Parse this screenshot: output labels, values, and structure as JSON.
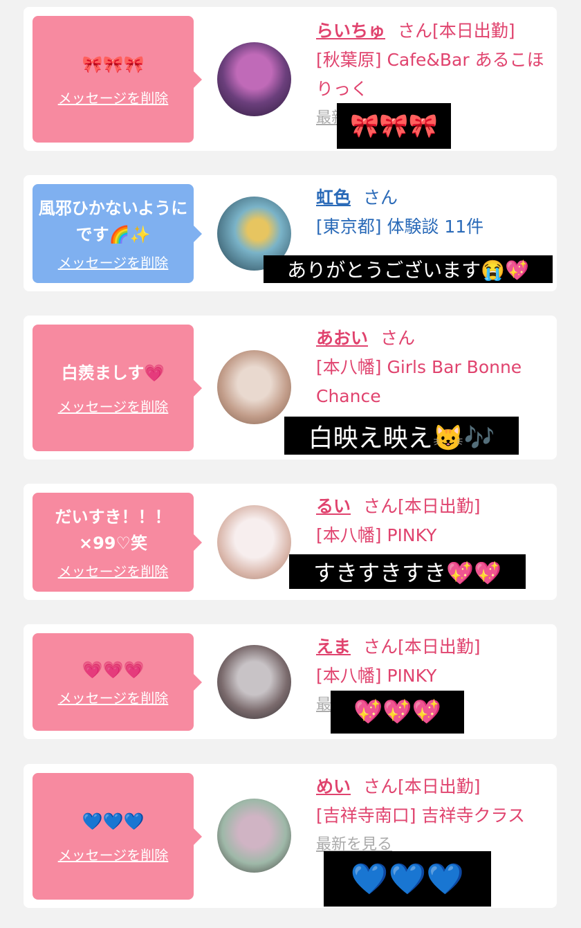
{
  "delete_label": "メッセージを削除",
  "see_latest_label": "最新を見る",
  "cards": [
    {
      "message": "🎀🎀🎀",
      "name": "らいちゅ",
      "suffix": "さん[本日出勤]",
      "shop": "[秋葉原] Cafe&Bar あるこほりっく",
      "overlay": "🎀🎀🎀",
      "avatar_colors": [
        "#2b1a3a",
        "#c06ab8",
        "#6b3f7c"
      ]
    },
    {
      "message": "風邪ひかないようにです🌈✨",
      "name": "虹色",
      "suffix": "さん",
      "shop": "[東京都] 体験談 11件",
      "overlay": "ありがとうございます😭💖",
      "avatar_colors": [
        "#1f3a48",
        "#7ab3c8",
        "#e7c560"
      ]
    },
    {
      "message": "白羨ましす💗",
      "name": "あおい",
      "suffix": "さん",
      "shop": "[本八幡] Girls Bar Bonne Chance",
      "overlay": "白映え映え😺🎶",
      "avatar_colors": [
        "#e9d9cf",
        "#c29d8a",
        "#7a5a48"
      ]
    },
    {
      "message": "だいすき！！！×99♡笑",
      "name": "るい",
      "suffix": "さん[本日出勤]",
      "shop": "[本八幡] PINKY",
      "overlay": "すきすきすき💖💖",
      "avatar_colors": [
        "#f7eeee",
        "#d9b6aa",
        "#a07d6c"
      ]
    },
    {
      "message": "💗💗💗",
      "name": "えま",
      "suffix": "さん[本日出勤]",
      "shop": "[本八幡] PINKY",
      "overlay": "💖💖💖",
      "avatar_colors": [
        "#2a2a2e",
        "#c8c3c6",
        "#7a6a6c"
      ]
    },
    {
      "message": "💙💙💙",
      "name": "めい",
      "suffix": "さん[本日出勤]",
      "shop": "[吉祥寺南口] 吉祥寺クラス",
      "overlay": "💙💙💙",
      "avatar_colors": [
        "#3a3232",
        "#9eb8a8",
        "#d0b4c4"
      ]
    }
  ]
}
